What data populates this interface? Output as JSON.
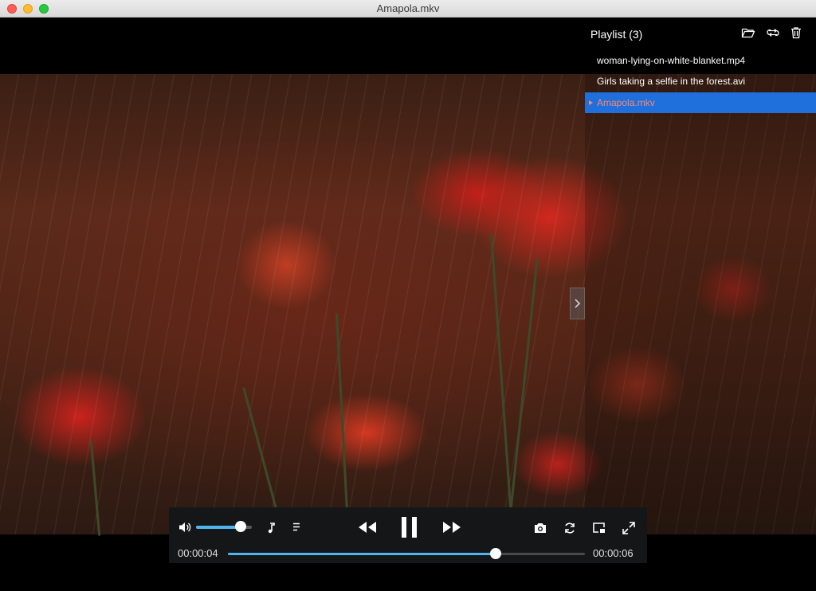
{
  "window": {
    "title": "Amapola.mkv"
  },
  "playlist": {
    "title": "Playlist (3)",
    "items": [
      {
        "label": "woman-lying-on-white-blanket.mp4",
        "active": false
      },
      {
        "label": "Girls taking a selfie in the forest.avi",
        "active": false
      },
      {
        "label": "Amapola.mkv",
        "active": true
      }
    ],
    "icons": [
      "folder-open-icon",
      "loop-icon",
      "trash-icon"
    ]
  },
  "player": {
    "current_time": "00:00:04",
    "total_time": "00:00:06",
    "progress": 0.75,
    "volume": 0.8,
    "state": "playing",
    "accent_color": "#4db4f0",
    "active_item_bg": "#1f6fdc",
    "active_item_text": "#ff8a6e"
  },
  "controls": {
    "icons": [
      "volume-icon",
      "music-note-icon",
      "subtitles-icon",
      "rewind-icon",
      "pause-icon",
      "fast-forward-icon",
      "screenshot-camera-icon",
      "repeat-icon",
      "picture-in-picture-icon",
      "fullscreen-icon"
    ]
  }
}
